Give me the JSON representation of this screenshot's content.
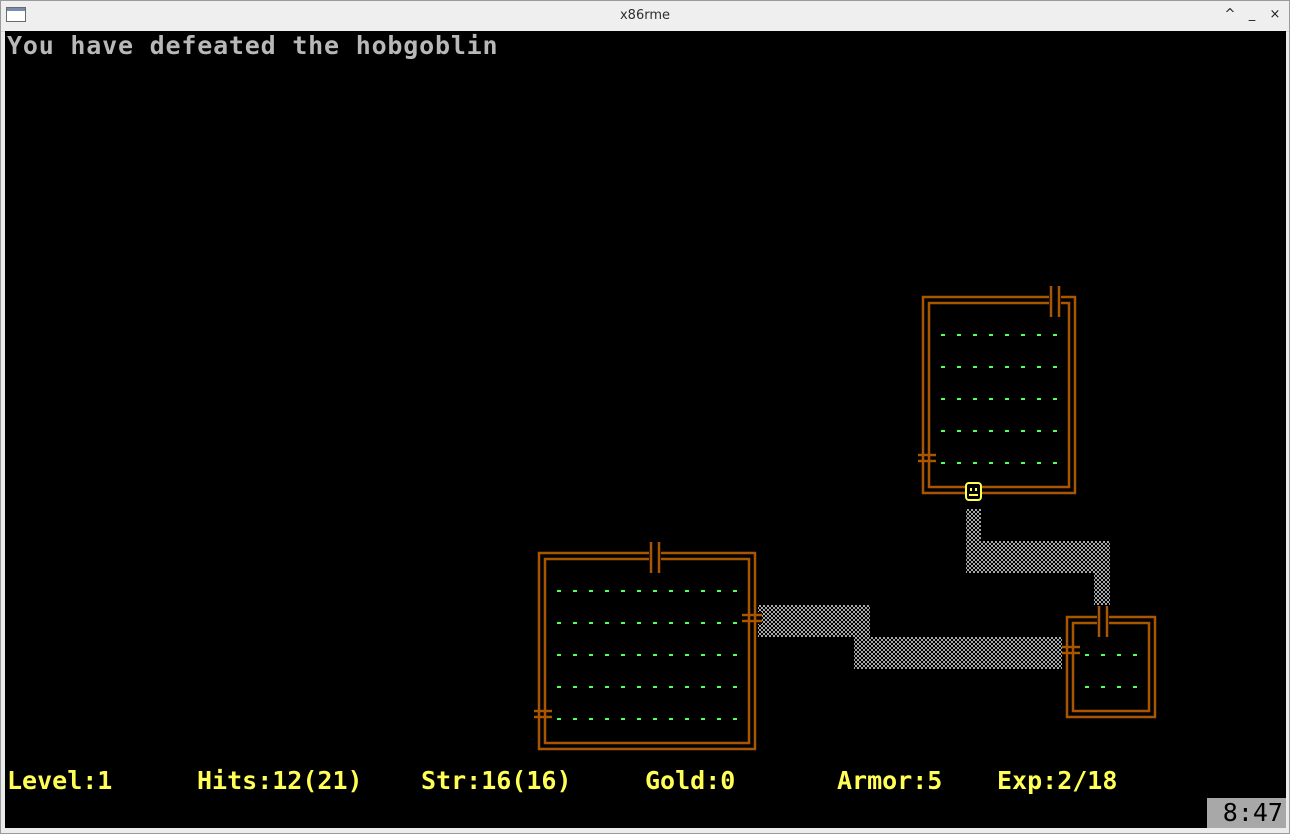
{
  "window": {
    "title": "x86rme",
    "controls": {
      "maximize": "^",
      "minimize": "_",
      "close": "×"
    }
  },
  "game": {
    "message": "You have defeated the hobgoblin",
    "status": {
      "level": "Level:1",
      "hits": "Hits:12(21)",
      "str": "Str:16(16)",
      "gold": "Gold:0",
      "armor": "Armor:5",
      "exp": "Exp:2/18"
    },
    "clock": "8:47",
    "colors": {
      "wall": "#aa5500",
      "floor": "#55ff55",
      "passage": "#a8a8a8",
      "player": "#ffff55",
      "status_text": "#ffff55",
      "message_text": "#b8b8b8"
    }
  }
}
